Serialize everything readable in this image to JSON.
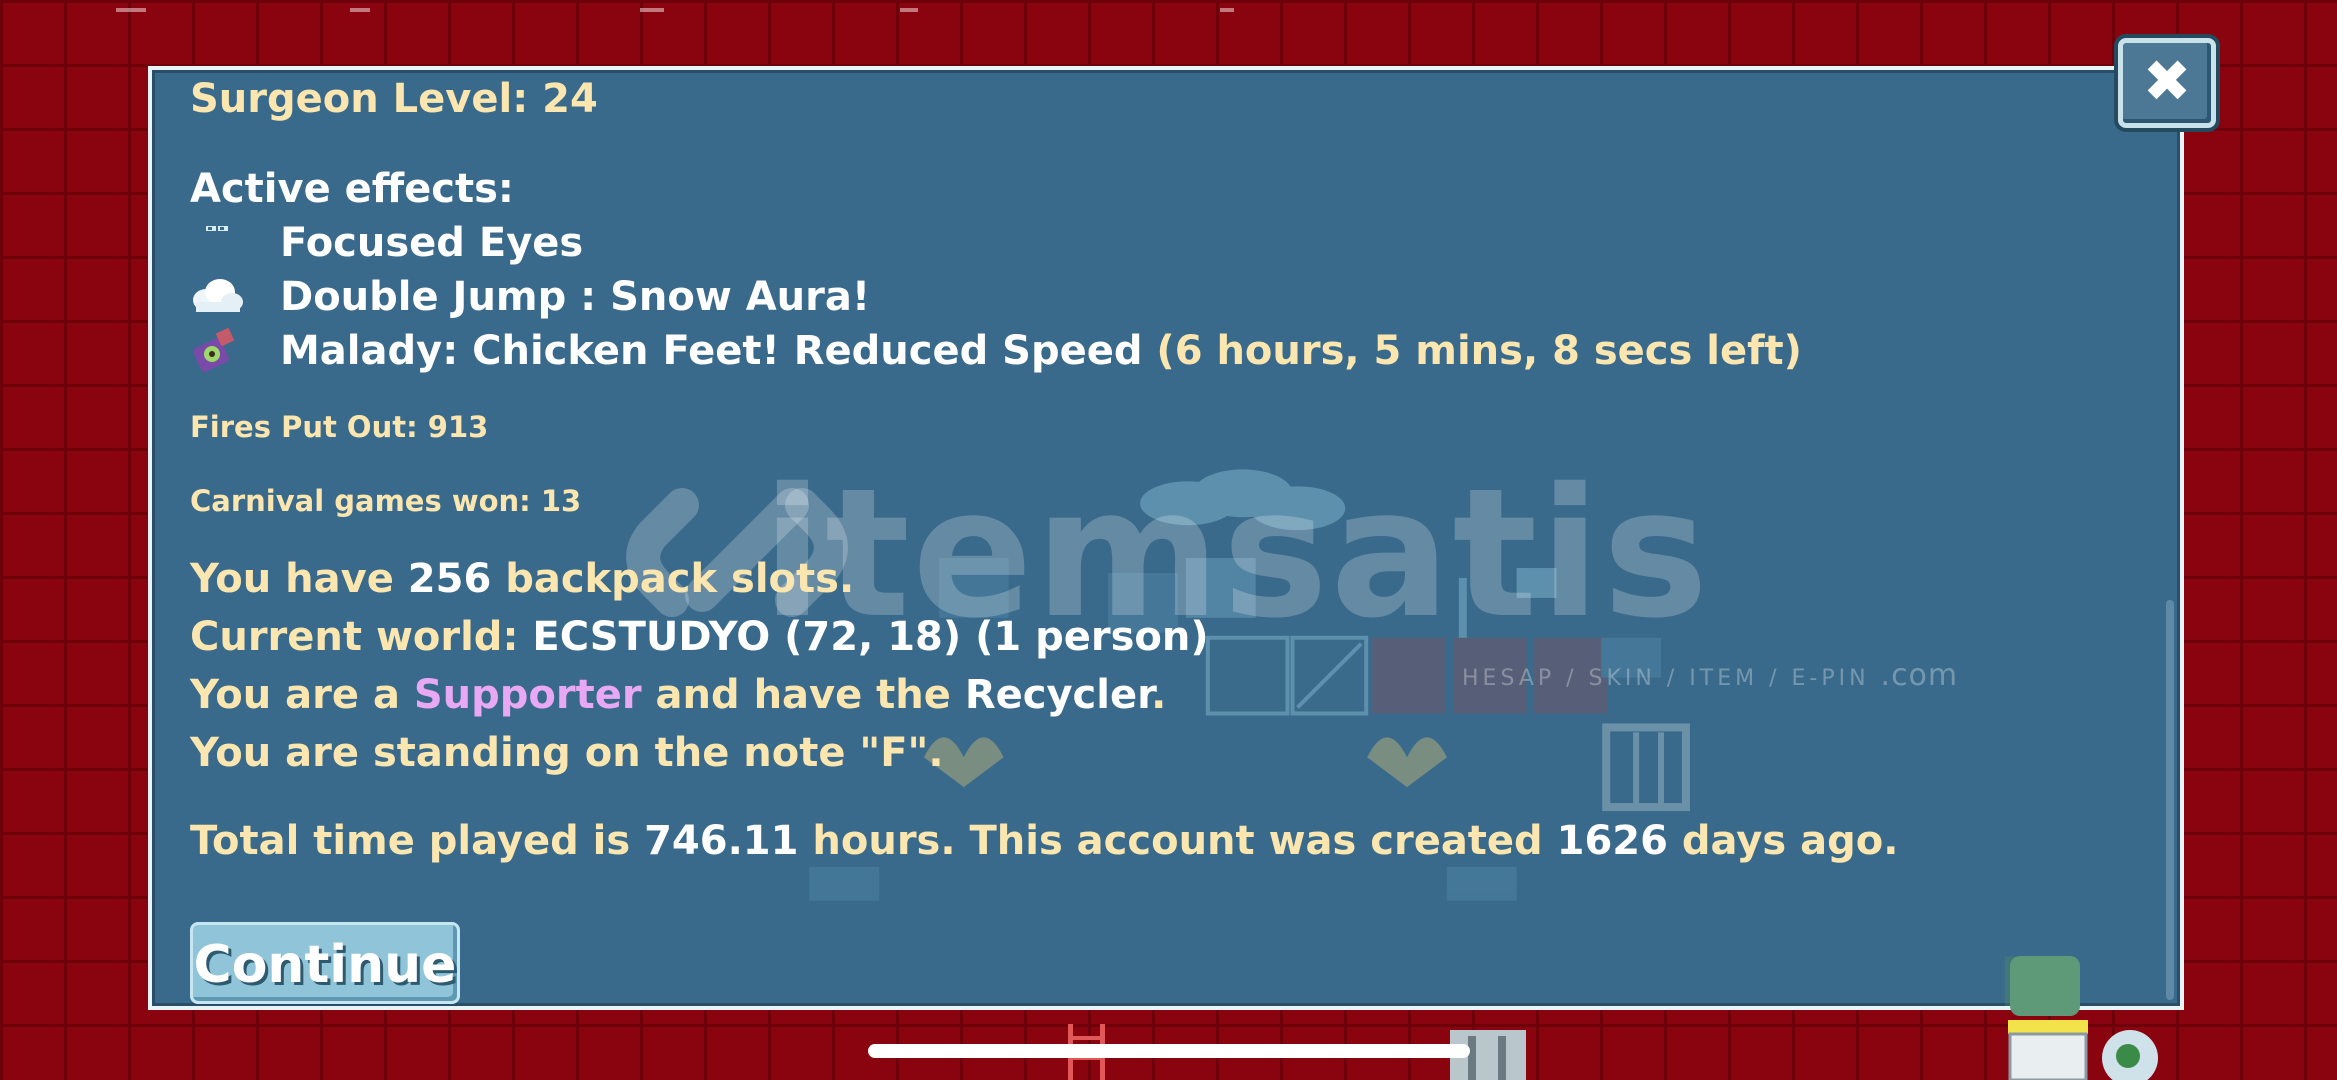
{
  "dialog": {
    "surgeon_level": "Surgeon Level: 24",
    "active_effects_heading": "Active effects:",
    "effects": [
      {
        "icon": "focused-eyes-icon",
        "label": "Focused Eyes",
        "timer": ""
      },
      {
        "icon": "snow-cloud-icon",
        "label": "Double Jump : Snow Aura!",
        "timer": ""
      },
      {
        "icon": "malady-potion-icon",
        "label": "Malady: Chicken Feet! Reduced Speed",
        "timer": "(6 hours, 5 mins, 8 secs left)"
      }
    ],
    "fires_put_out": "Fires Put Out: 913",
    "carnival_games_won": "Carnival games won: 13",
    "backpack": {
      "prefix": "You have ",
      "value": "256",
      "suffix": " backpack slots."
    },
    "world": {
      "prefix": "Current world: ",
      "value": "ECSTUDYO (72, 18) (1 person)"
    },
    "supporter": {
      "prefix": "You are a ",
      "role": "Supporter",
      "middle": " and have the ",
      "item": "Recycler",
      "suffix": "."
    },
    "note": "You are standing on the note \"F\".",
    "playtime": {
      "prefix": "Total time played is ",
      "hours": "746.11",
      "middle": " hours.  This account was created ",
      "days": "1626",
      "suffix": " days ago."
    },
    "continue_label": "Continue",
    "close_label": "✖"
  },
  "watermark": {
    "text": "itemsatis",
    "sub": "HESAP / SKIN / ITEM / E-PIN",
    "domain": ".com"
  },
  "colors": {
    "panel": "#3a6a8b",
    "cream_text": "#fbe6b0",
    "supporter": "#e8a8f4",
    "background_red": "#8a0410"
  }
}
